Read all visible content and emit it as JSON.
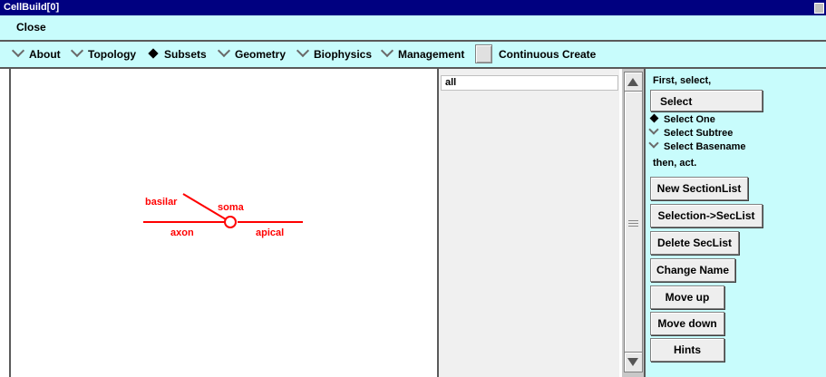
{
  "window": {
    "title": "CellBuild[0]"
  },
  "menubar": {
    "close_label": "Close"
  },
  "tabs": [
    {
      "label": "About",
      "selected": false
    },
    {
      "label": "Topology",
      "selected": false
    },
    {
      "label": "Subsets",
      "selected": true
    },
    {
      "label": "Geometry",
      "selected": false
    },
    {
      "label": "Biophysics",
      "selected": false
    },
    {
      "label": "Management",
      "selected": false
    }
  ],
  "continuous_create": {
    "label": "Continuous Create",
    "checked": false
  },
  "shape_plot": {
    "labels": {
      "basilar": "basilar",
      "soma": "soma",
      "axon": "axon",
      "apical": "apical"
    },
    "color": "#ff0000"
  },
  "subset_list": {
    "items": [
      "all"
    ]
  },
  "right_panel": {
    "first_select": "First, select,",
    "select_button": "Select",
    "select_options": [
      {
        "label": "Select One",
        "selected": true
      },
      {
        "label": "Select Subtree",
        "selected": false
      },
      {
        "label": "Select Basename",
        "selected": false
      }
    ],
    "then_act": "then, act.",
    "buttons": {
      "new_sectionlist": "New SectionList",
      "selection_to_seclist": "Selection->SecList",
      "delete_seclist": "Delete SecList",
      "change_name": "Change Name",
      "move_up": "Move up",
      "move_down": "Move down",
      "hints": "Hints"
    }
  },
  "colors": {
    "panel_bg": "#c8fcfc",
    "titlebar": "#000080",
    "shape": "#ff0000"
  }
}
